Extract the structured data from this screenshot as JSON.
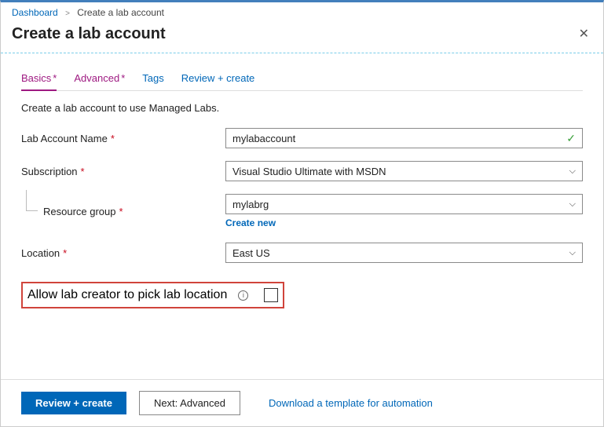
{
  "breadcrumb": {
    "root": "Dashboard",
    "current": "Create a lab account"
  },
  "header": {
    "title": "Create a lab account"
  },
  "tabs": {
    "basics": "Basics",
    "advanced": "Advanced",
    "tags": "Tags",
    "review": "Review + create"
  },
  "intro": "Create a lab account to use Managed Labs.",
  "labels": {
    "labAccountName": "Lab Account Name",
    "subscription": "Subscription",
    "resourceGroup": "Resource group",
    "location": "Location",
    "allowPick": "Allow lab creator to pick lab location"
  },
  "values": {
    "labAccountName": "mylabaccount",
    "subscription": "Visual Studio Ultimate with MSDN",
    "resourceGroup": "mylabrg",
    "location": "East US"
  },
  "links": {
    "createNew": "Create new",
    "downloadTemplate": "Download a template for automation"
  },
  "buttons": {
    "review": "Review + create",
    "next": "Next: Advanced"
  }
}
